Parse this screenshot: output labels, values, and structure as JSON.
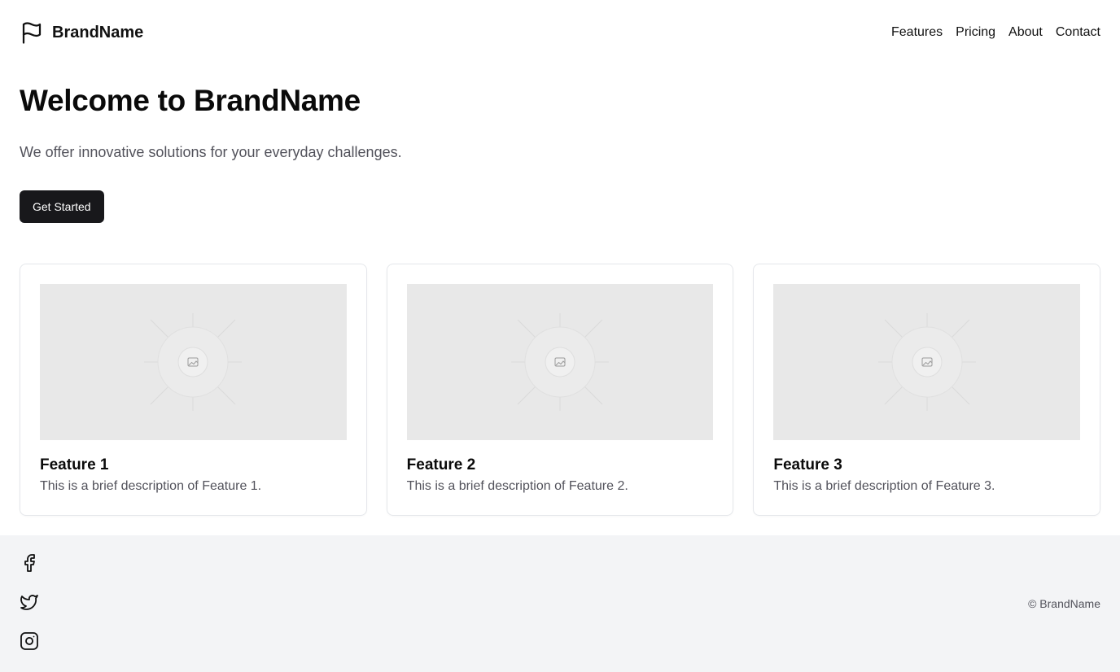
{
  "header": {
    "brand_name": "BrandName",
    "brand_icon": "flag-icon",
    "nav": [
      {
        "label": "Features"
      },
      {
        "label": "Pricing"
      },
      {
        "label": "About"
      },
      {
        "label": "Contact"
      }
    ]
  },
  "hero": {
    "title": "Welcome to BrandName",
    "subtitle": "We offer innovative solutions for your everyday challenges.",
    "cta_label": "Get Started"
  },
  "features": [
    {
      "title": "Feature 1",
      "description": "This is a brief description of Feature 1.",
      "image_icon": "image-placeholder-icon"
    },
    {
      "title": "Feature 2",
      "description": "This is a brief description of Feature 2.",
      "image_icon": "image-placeholder-icon"
    },
    {
      "title": "Feature 3",
      "description": "This is a brief description of Feature 3.",
      "image_icon": "image-placeholder-icon"
    }
  ],
  "footer": {
    "social": [
      "facebook-icon",
      "twitter-icon",
      "instagram-icon"
    ],
    "copyright": "© BrandName"
  },
  "colors": {
    "primary_button": "#18181b",
    "footer_bg": "#f3f4f6",
    "muted_text": "#52525b",
    "placeholder_bg": "#e8e8e8"
  }
}
